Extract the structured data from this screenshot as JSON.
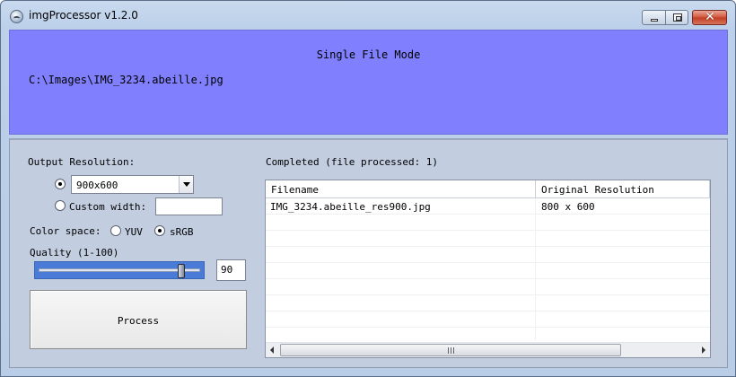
{
  "window": {
    "title": "imgProcessor v1.2.0",
    "icons": {
      "app": "app-globe-icon",
      "minimize": "minimize-icon",
      "maximize": "restore-icon",
      "close": "close-icon"
    },
    "close_glyph": "✕"
  },
  "banner": {
    "mode_title": "Single File Mode",
    "file_path": "C:\\Images\\IMG_3234.abeille.jpg",
    "background_color": "#8080ff"
  },
  "settings": {
    "output_resolution_label": "Output Resolution:",
    "resolution_selected": "900x600",
    "custom_width_label": "Custom width:",
    "custom_width_value": "",
    "color_space_label": "Color space:",
    "color_space_options": [
      "YUV",
      "sRGB"
    ],
    "color_space_selected": "sRGB",
    "quality_label": "Quality (1-100)",
    "quality_value": "90",
    "quality_fraction": 0.9,
    "process_label": "Process"
  },
  "results": {
    "status": "Completed (file processed: 1)",
    "columns": [
      "Filename",
      "Original Resolution"
    ],
    "rows": [
      {
        "filename": "IMG_3234.abeille_res900.jpg",
        "original_resolution": "800 x 600"
      }
    ],
    "scroll_grip": "III"
  }
}
